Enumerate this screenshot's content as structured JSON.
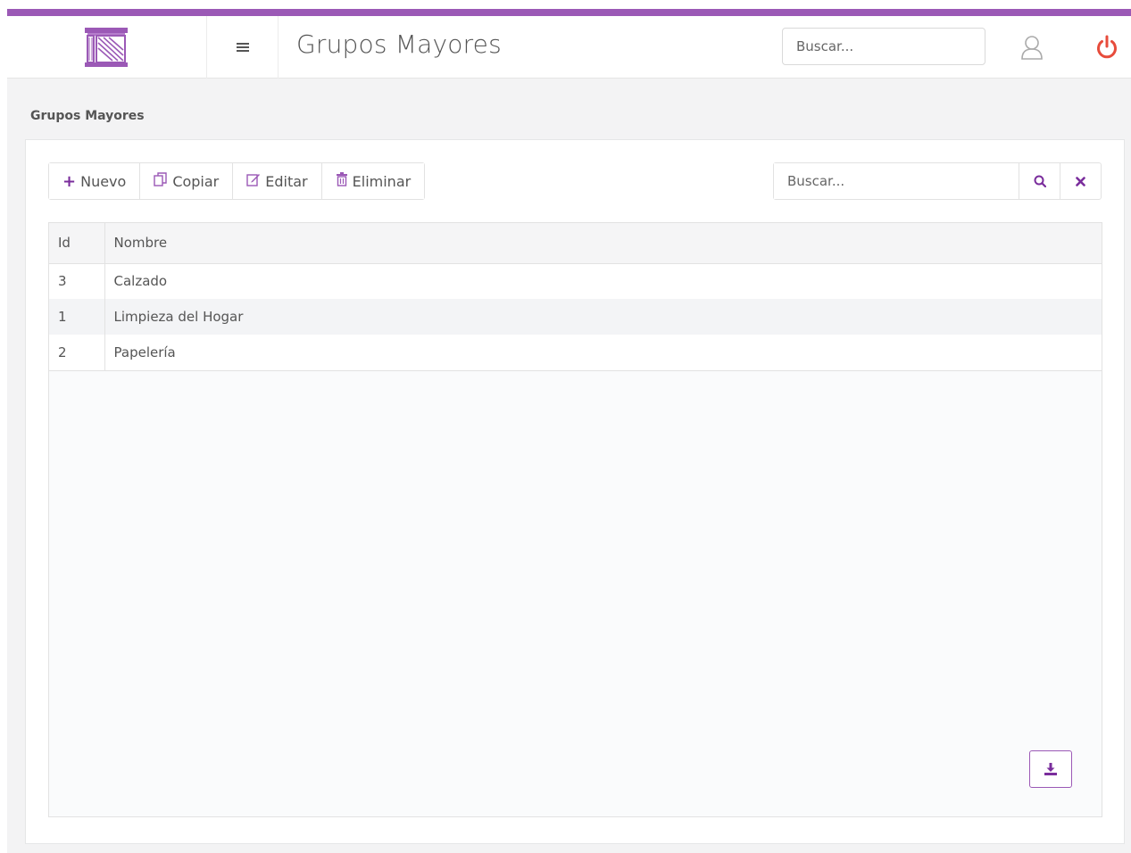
{
  "header": {
    "title": "Grupos Mayores",
    "search_placeholder": "Buscar...",
    "logo_icon": "building-columns-logo-icon",
    "menu_icon": "hamburger-menu-icon",
    "user_icon": "user-icon",
    "power_icon": "power-icon"
  },
  "breadcrumb": "Grupos Mayores",
  "toolbar": {
    "new_label": "Nuevo",
    "copy_label": "Copiar",
    "edit_label": "Editar",
    "delete_label": "Eliminar"
  },
  "grid_search": {
    "placeholder": "Buscar..."
  },
  "table": {
    "columns": [
      "Id",
      "Nombre"
    ],
    "rows": [
      {
        "id": "3",
        "nombre": "Calzado"
      },
      {
        "id": "1",
        "nombre": "Limpieza del Hogar"
      },
      {
        "id": "2",
        "nombre": "Papelería"
      }
    ]
  },
  "colors": {
    "accent": "#9b59b6",
    "accent_dark": "#7a2d9c",
    "power": "#e74c3c"
  }
}
